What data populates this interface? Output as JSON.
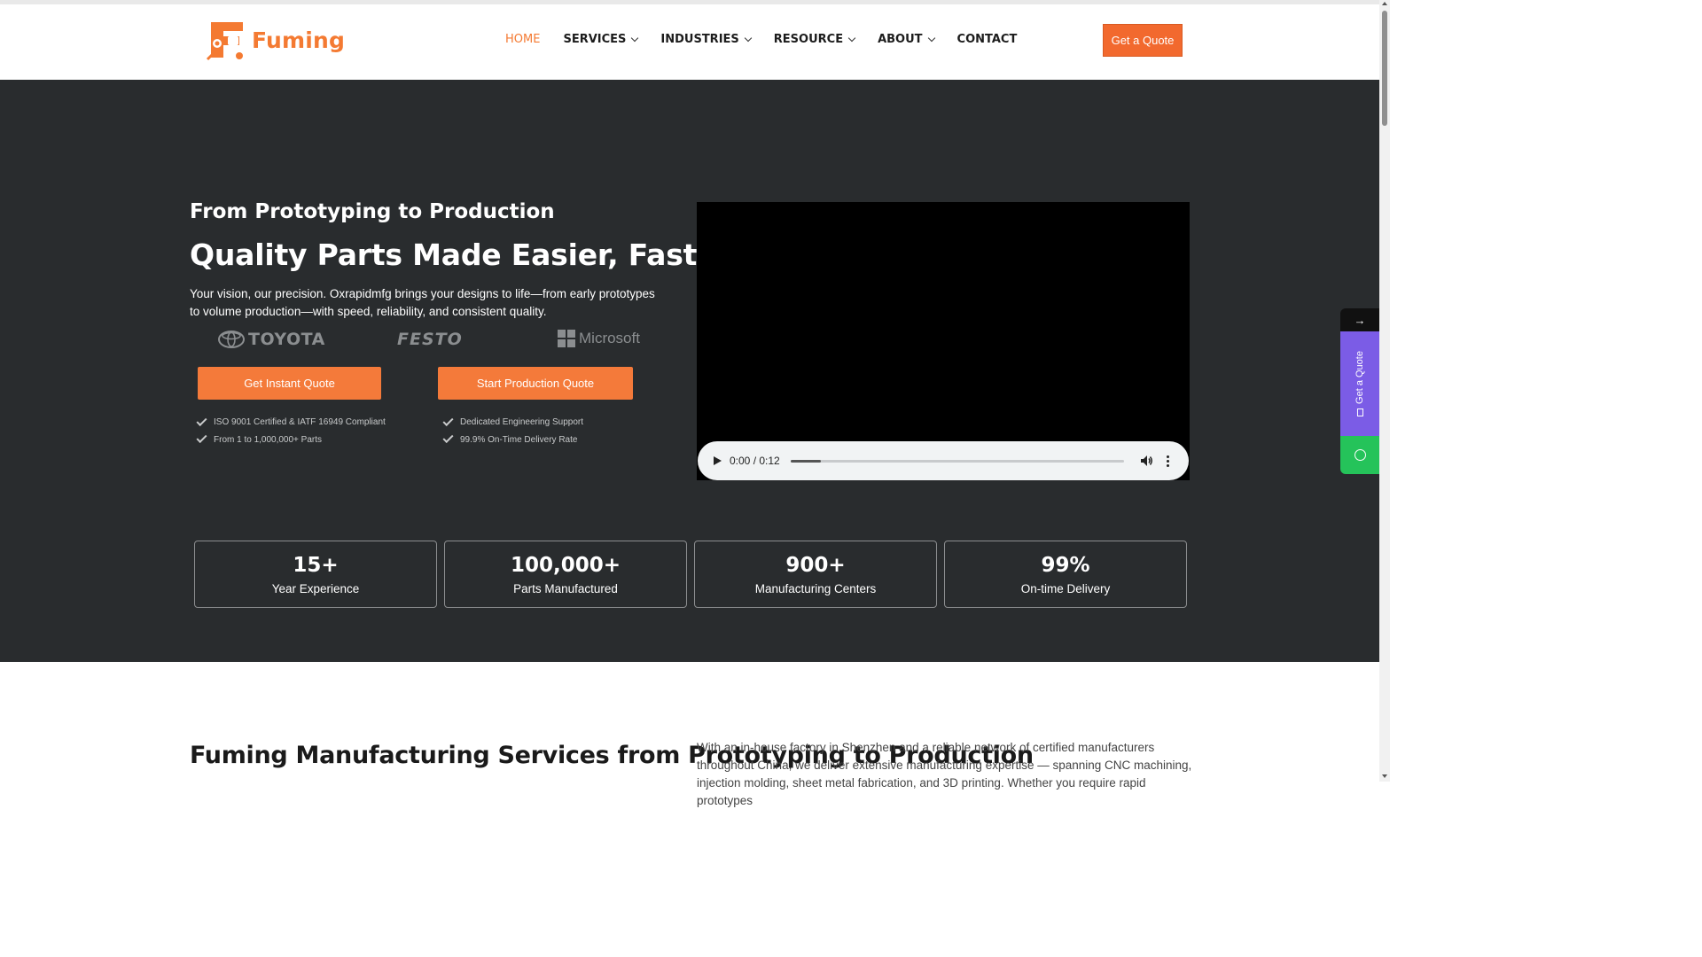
{
  "header": {
    "logo_text": "Fuming",
    "nav": [
      {
        "label": "HOME",
        "active": true,
        "has_dropdown": false
      },
      {
        "label": "SERVICES",
        "active": false,
        "has_dropdown": true
      },
      {
        "label": "INDUSTRIES",
        "active": false,
        "has_dropdown": true
      },
      {
        "label": "RESOURCE",
        "active": false,
        "has_dropdown": true
      },
      {
        "label": "ABOUT",
        "active": false,
        "has_dropdown": true
      },
      {
        "label": "CONTACT",
        "active": false,
        "has_dropdown": false
      }
    ],
    "cta_label": "Get a Quote"
  },
  "hero": {
    "subtitle": "From Prototyping to Production",
    "title": "Quality Parts Made Easier, Faster",
    "description": "Your vision, our precision. Oxrapidmfg brings your designs to life—from early prototypes to volume production—with speed, reliability, and consistent quality.",
    "brands": [
      "TOYOTA",
      "FESTO",
      "Microsoft"
    ],
    "buttons": {
      "instant": "Get Instant Quote",
      "production": "Start Production Quote"
    },
    "checks_left": [
      "ISO 9001 Certified & IATF 16949 Compliant",
      "From 1 to 1,000,000+ Parts"
    ],
    "checks_right": [
      "Dedicated Engineering Support",
      "99.9% On-Time Delivery Rate"
    ],
    "video": {
      "time": "0:00 / 0:12",
      "progress": 0.09
    }
  },
  "stats": [
    {
      "value": "15+",
      "label": "Year Experience"
    },
    {
      "value": "100,000+",
      "label": "Parts Manufactured"
    },
    {
      "value": "900+",
      "label": "Manufacturing Centers"
    },
    {
      "value": "99%",
      "label": "On-time Delivery"
    }
  ],
  "section": {
    "title": "Fuming Manufacturing Services from Prototyping to Production",
    "text": "With an in-house factory in Shenzhen and a reliable network of certified manufacturers throughout China, we deliver extensive manufacturing expertise — spanning CNC machining, injection molding, sheet metal fabrication, and 3D printing. Whether you require rapid prototypes"
  },
  "side_widget": {
    "arrow": "→",
    "quote_label": "Get a Quote"
  },
  "colors": {
    "accent": "#f47a32",
    "hero_bg": "#292c2e",
    "side_quote": "#7b5ce6",
    "side_whatsapp": "#25c35a"
  }
}
